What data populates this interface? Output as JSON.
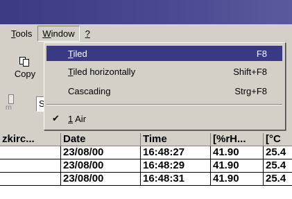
{
  "menubar": {
    "items": [
      {
        "label": "Tools",
        "mnemonic": "T",
        "rest": "ools"
      },
      {
        "label": "Window",
        "mnemonic": "W",
        "rest": "indow"
      },
      {
        "label": "?",
        "mnemonic": "?",
        "rest": ""
      }
    ]
  },
  "toolbar": {
    "copy_label": "Copy",
    "field_value": "S",
    "small_text": "rn",
    "right_text": "l"
  },
  "window_menu": {
    "items": [
      {
        "label": "Tiled",
        "mnemonic": "T",
        "rest": "iled",
        "shortcut": "F8",
        "selected": true
      },
      {
        "label": "Tiled horizontally",
        "mnemonic": "T",
        "rest": "iled horizontally",
        "shortcut": "Shift+F8",
        "selected": false
      },
      {
        "label": "Cascading",
        "mnemonic": "",
        "rest": "Cascading",
        "shortcut": "Strg+F8",
        "selected": false
      }
    ],
    "window_list": [
      {
        "label": "1 Air",
        "mnemonic": "1",
        "rest": " Air",
        "checked": true
      }
    ],
    "check_glyph": "✔"
  },
  "table": {
    "headers": [
      "zkirc...",
      "Date",
      "Time",
      "[%rH...",
      "[°C"
    ],
    "rows": [
      [
        "",
        "23/08/00",
        "16:48:27",
        "41.90",
        "25.4"
      ],
      [
        "",
        "23/08/00",
        "16:48:29",
        "41.90",
        "25.4"
      ],
      [
        "",
        "23/08/00",
        "16:48:31",
        "41.90",
        "25.4"
      ]
    ]
  }
}
